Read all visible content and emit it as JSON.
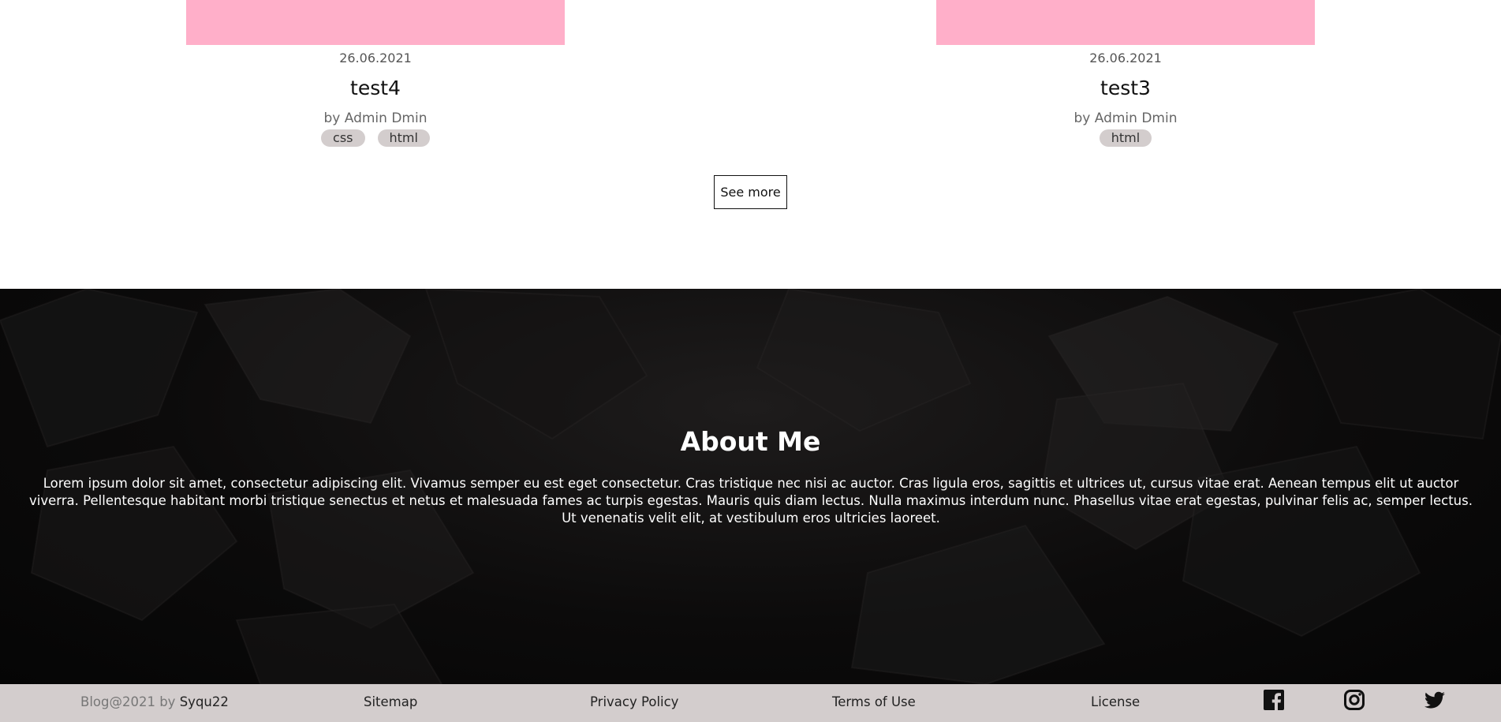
{
  "posts": [
    {
      "date": "26.06.2021",
      "title": "test4",
      "author": "by Admin Dmin",
      "tags": [
        "css",
        "html"
      ]
    },
    {
      "date": "26.06.2021",
      "title": "test3",
      "author": "by Admin Dmin",
      "tags": [
        "html"
      ]
    }
  ],
  "see_more_label": "See more",
  "about": {
    "title": "About Me",
    "text": "Lorem ipsum dolor sit amet, consectetur adipiscing elit. Vivamus semper eu est eget consectetur. Cras tristique nec nisi ac auctor. Cras ligula eros, sagittis et ultrices ut, cursus vitae erat. Aenean tempus elit ut auctor viverra. Pellentesque habitant morbi tristique senectus et netus et malesuada fames ac turpis egestas. Mauris quis diam lectus. Nulla maximus interdum nunc. Phasellus vitae erat egestas, pulvinar felis ac, semper lectus. Ut venenatis velit elit, at vestibulum eros ultricies laoreet."
  },
  "footer": {
    "copyright_prefix": "Blog@2021 by ",
    "copyright_author": "Syqu22",
    "links": {
      "sitemap": "Sitemap",
      "privacy": "Privacy Policy",
      "terms": "Terms of Use",
      "license": "License"
    },
    "social_icons": [
      "facebook-icon",
      "instagram-icon",
      "twitter-icon"
    ]
  },
  "colors": {
    "thumbnail": "#ffafc9",
    "tag_bg": "#d3cdcd",
    "footer_bg": "#d3cdcd",
    "about_bg": "#0a0909"
  }
}
